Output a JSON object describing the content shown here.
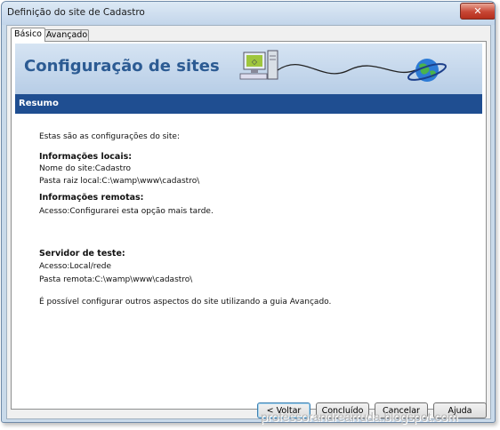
{
  "window": {
    "title": "Definição do site de Cadastro",
    "close_label": "✕"
  },
  "tabs": [
    {
      "label": "Básico",
      "active": true
    },
    {
      "label": "Avançado",
      "active": false
    }
  ],
  "banner": {
    "title": "Configuração de sites"
  },
  "section": {
    "label": "Resumo"
  },
  "summary": {
    "intro": "Estas são as configurações do site:",
    "local": {
      "heading": "Informações locais:",
      "site_name": "Nome do site:Cadastro",
      "root_folder": "Pasta raiz local:C:\\wamp\\www\\cadastro\\"
    },
    "remote": {
      "heading": "Informações remotas:",
      "access": "Acesso:Configurarei esta opção mais tarde."
    },
    "test_server": {
      "heading": "Servidor de teste:",
      "access": "Acesso:Local/rede",
      "remote_folder": "Pasta remota:C:\\wamp\\www\\cadastro\\"
    },
    "footer_note": "É possível configurar outros aspectos do site utilizando a guia Avançado."
  },
  "buttons": {
    "back": "< Voltar",
    "done": "Concluído",
    "cancel": "Cancelar",
    "help": "Ajuda"
  },
  "watermark": "professorandrearruda.blogspot.com",
  "colors": {
    "titlebar": "#c9daea",
    "banner_title": "#2c5b93",
    "section_bar": "#1f4e91",
    "close_button": "#c74634"
  }
}
